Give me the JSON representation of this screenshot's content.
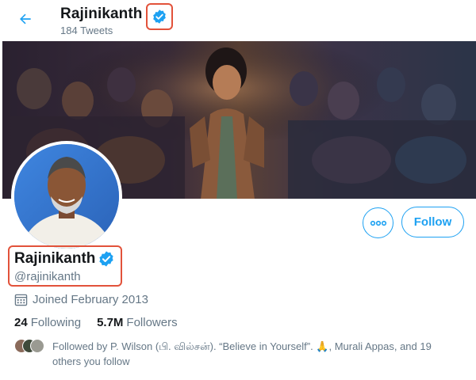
{
  "header": {
    "name": "Rajinikanth",
    "tweet_count": "184 Tweets"
  },
  "actions": {
    "follow_label": "Follow"
  },
  "profile": {
    "name": "Rajinikanth",
    "handle": "@rajinikanth",
    "joined": "Joined February 2013",
    "following_count": "24",
    "following_label": "Following",
    "followers_count": "5.7M",
    "followers_label": "Followers",
    "followed_by_line1": "Followed by P. Wilson (பி. வில்சன்). “Believe in Yourself”. 🙏, Murali Appas, and 19",
    "followed_by_line2": "others you follow"
  },
  "colors": {
    "accent": "#1da1f2",
    "highlight": "#e2523a",
    "muted": "#657786",
    "text": "#14171a"
  },
  "icons": [
    "back-arrow-icon",
    "verified-badge-icon",
    "more-icon",
    "calendar-icon"
  ]
}
